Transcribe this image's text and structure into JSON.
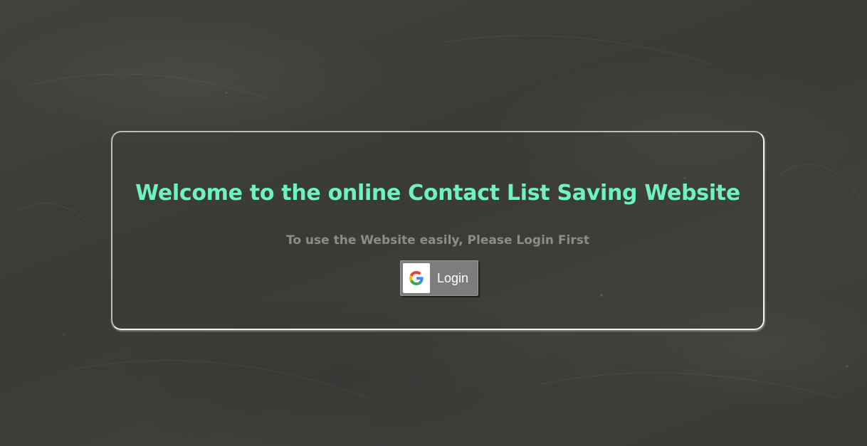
{
  "card": {
    "title": "Welcome to the online Contact List Saving Website",
    "subtitle": "To use the Website easily, Please Login First"
  },
  "login_button": {
    "label": "Login",
    "icon": "google-icon"
  },
  "colors": {
    "title": "#6ef2c2",
    "subtitle": "#8c8d88",
    "button_bg": "#7d7d7b",
    "background": "#3d3e3a"
  }
}
